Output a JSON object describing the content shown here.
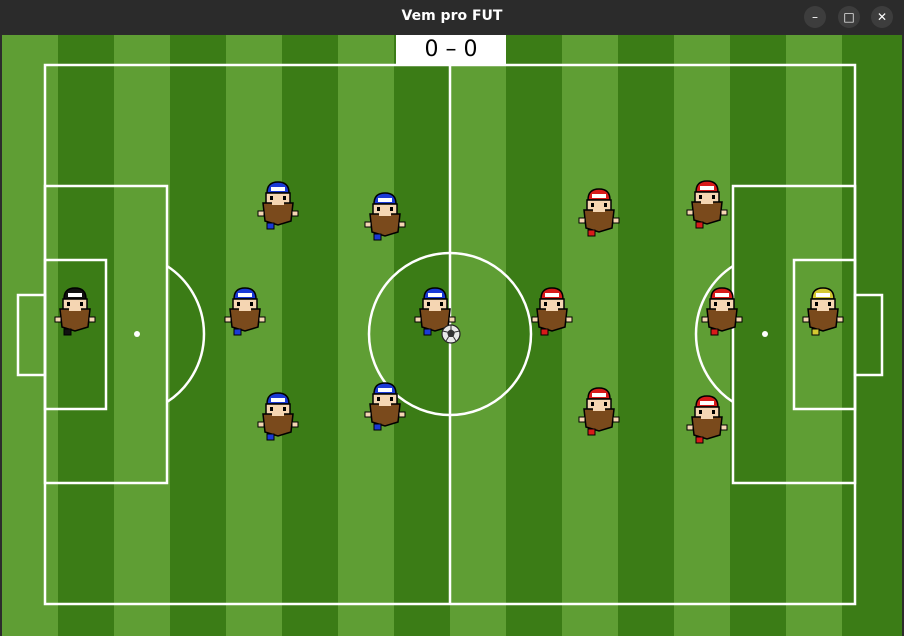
{
  "window": {
    "title": "Vem pro FUT",
    "buttons": {
      "minimize": "–",
      "maximize": "□",
      "close": "✕"
    }
  },
  "scoreboard": {
    "text": "0 – 0"
  },
  "colors": {
    "grass_dark": "#3b7c16",
    "grass_light": "#5f9e34",
    "lines": "#ffffff",
    "team_blue": "#1a3ad6",
    "team_red": "#d81a1a",
    "goalkeeper_left": "#111111",
    "goalkeeper_right": "#d4c832",
    "skin": "#f5d6b3",
    "beard": "#7a4a1c"
  },
  "teams": {
    "left": {
      "color": "blue",
      "goalkeeper": "black"
    },
    "right": {
      "color": "red",
      "goalkeeper": "yellow"
    }
  },
  "icons": {
    "ball": "soccer-ball-icon",
    "player": "player-sprite-icon"
  }
}
